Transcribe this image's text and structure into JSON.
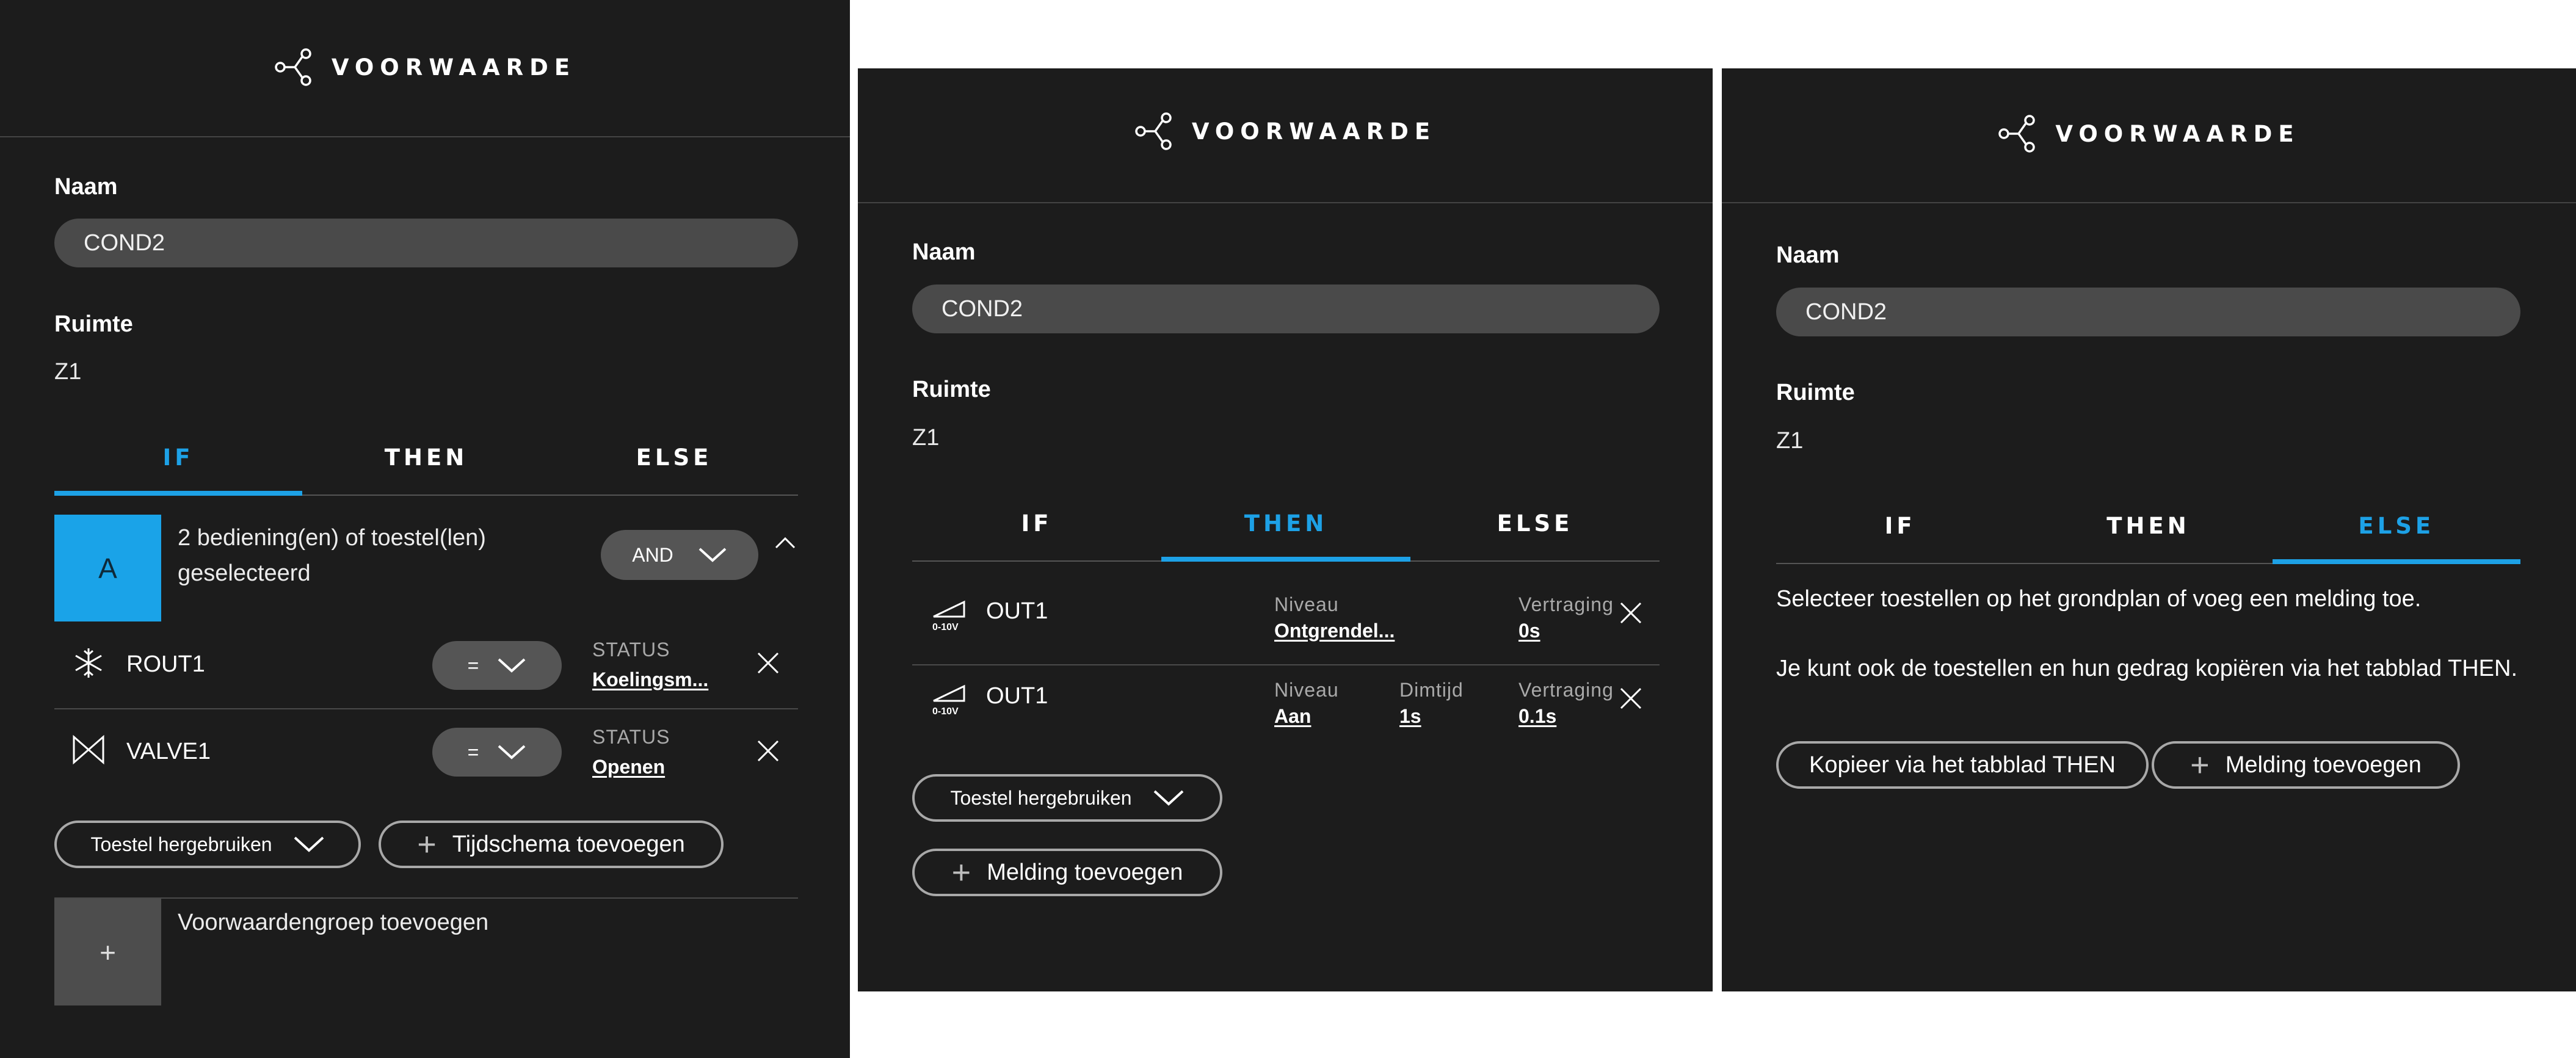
{
  "panels": [
    {
      "header_title": "VOORWAARDE",
      "name_label": "Naam",
      "name_value": "COND2",
      "room_label": "Ruimte",
      "room_value": "Z1",
      "tabs": [
        {
          "label": "IF",
          "active": true
        },
        {
          "label": "THEN",
          "active": false
        },
        {
          "label": "ELSE",
          "active": false
        }
      ],
      "group": {
        "badge": "A",
        "text_line1": "2 bediening(en) of toestel(len)",
        "text_line2": "geselecteerd",
        "operator": "AND"
      },
      "devices": [
        {
          "name": "ROUT1",
          "icon": "snowflake-icon",
          "op": "=",
          "status_label": "STATUS",
          "status_value": "Koelingsm..."
        },
        {
          "name": "VALVE1",
          "icon": "valve-icon",
          "op": "=",
          "status_label": "STATUS",
          "status_value": "Openen"
        }
      ],
      "reuse_button": "Toestel hergebruiken",
      "schedule_button": "Tijdschema toevoegen",
      "add_group_badge": "+",
      "add_group_label": "Voorwaardengroep toevoegen"
    },
    {
      "header_title": "VOORWAARDE",
      "name_label": "Naam",
      "name_value": "COND2",
      "room_label": "Ruimte",
      "room_value": "Z1",
      "tabs": [
        {
          "label": "IF",
          "active": false
        },
        {
          "label": "THEN",
          "active": true
        },
        {
          "label": "ELSE",
          "active": false
        }
      ],
      "outputs": [
        {
          "icon_label": "0-10V",
          "name": "OUT1",
          "level_label": "Niveau",
          "level_value": "Ontgrendel...",
          "delay_label": "Vertraging",
          "delay_value": "0s"
        },
        {
          "icon_label": "0-10V",
          "name": "OUT1",
          "level_label": "Niveau",
          "level_value": "Aan",
          "dim_label": "Dimtijd",
          "dim_value": "1s",
          "delay_label": "Vertraging",
          "delay_value": "0.1s"
        }
      ],
      "reuse_button": "Toestel hergebruiken",
      "notification_button": "Melding toevoegen"
    },
    {
      "header_title": "VOORWAARDE",
      "name_label": "Naam",
      "name_value": "COND2",
      "room_label": "Ruimte",
      "room_value": "Z1",
      "tabs": [
        {
          "label": "IF",
          "active": false
        },
        {
          "label": "THEN",
          "active": false
        },
        {
          "label": "ELSE",
          "active": true
        }
      ],
      "text_line1": "Selecteer toestellen op het grondplan of voeg een melding toe.",
      "text_line2": "Je kunt ook de toestellen en hun gedrag kopiëren via het tabblad THEN.",
      "copy_button": "Kopieer via het tabblad THEN",
      "notification_button": "Melding toevoegen"
    }
  ],
  "colors": {
    "background": "#1c1c1c",
    "accent": "#1da1e6",
    "field": "#4a4a4a",
    "group_badge": "#1aa3e8",
    "add_group_badge": "#4d4d4d"
  }
}
